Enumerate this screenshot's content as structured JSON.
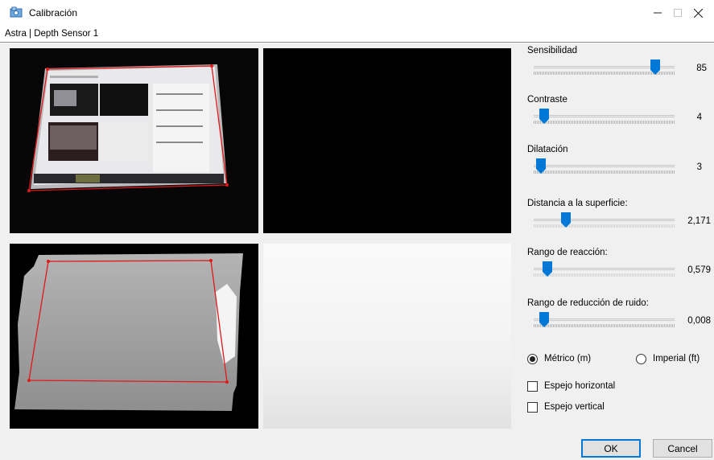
{
  "window": {
    "title": "Calibración",
    "device": "Astra | Depth Sensor 1"
  },
  "sliders": [
    {
      "id": "sensibilidad",
      "label": "Sensibilidad",
      "value_text": "85",
      "fraction": 0.85
    },
    {
      "id": "contraste",
      "label": "Contraste",
      "value_text": "4",
      "fraction": 0.04
    },
    {
      "id": "dilatacion",
      "label": "Dilatación",
      "value_text": "3",
      "fraction": 0.02
    },
    {
      "id": "distancia",
      "label": "Distancia a la superficie:",
      "value_text": "2,171",
      "fraction": 0.2
    },
    {
      "id": "rango-reaccion",
      "label": "Rango de reacción:",
      "value_text": "0,579",
      "fraction": 0.07
    },
    {
      "id": "rango-ruido",
      "label": "Rango de reducción de ruido:",
      "value_text": "0,008",
      "fraction": 0.05
    }
  ],
  "units": {
    "metric_label": "Métrico (m)",
    "imperial_label": "Imperial (ft)",
    "selected": "metric"
  },
  "options": {
    "mirror_horizontal_label": "Espejo horizontal",
    "mirror_horizontal_checked": false,
    "mirror_vertical_label": "Espejo vertical",
    "mirror_vertical_checked": false
  },
  "buttons": {
    "ok": "OK",
    "cancel": "Cancel"
  },
  "colors": {
    "accent": "#0078d7",
    "calibration_outline": "#e01818"
  },
  "icons": {
    "app": "calibration-app-icon",
    "minimize": "minimize-icon",
    "maximize": "maximize-icon",
    "close": "close-icon"
  }
}
